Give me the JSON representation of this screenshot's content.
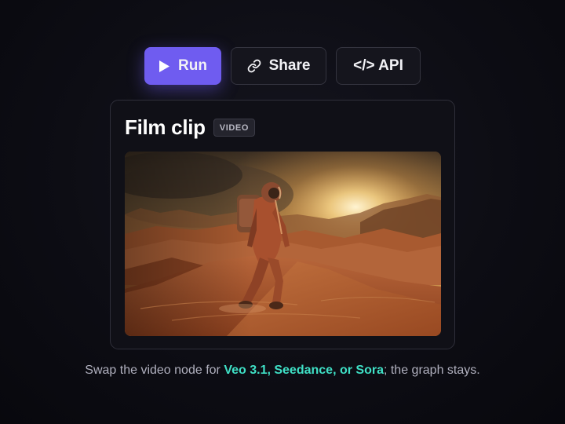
{
  "toolbar": {
    "run_label": "Run",
    "share_label": "Share",
    "api_label": "</> API"
  },
  "icons": {
    "run": "play-icon",
    "share": "link-icon"
  },
  "card": {
    "title": "Film clip",
    "badge": "VIDEO",
    "media": "Astronaut in orange spacesuit walking across desert dunes toward a hazy sun"
  },
  "caption": {
    "prefix": "Swap the video node for ",
    "highlight": "Veo 3.1, Seedance, or Sora",
    "suffix": "; the graph stays."
  },
  "colors": {
    "accent": "#6f5cf0",
    "highlight": "#3fe0c6",
    "background": "#0d0d14"
  }
}
